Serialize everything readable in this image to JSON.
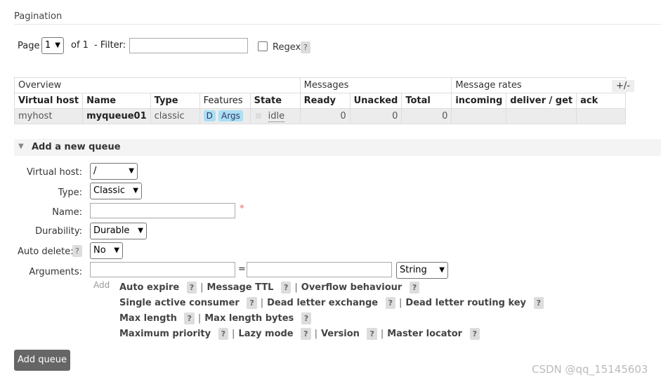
{
  "pagination": {
    "heading": "Pagination",
    "page_label": "Page",
    "page_value": "1",
    "of_label": "of 1",
    "filter_label": "- Filter:",
    "filter_value": "",
    "regex_label": "Regex",
    "help": "?"
  },
  "table": {
    "group_headers": [
      "Overview",
      "Messages",
      "Message rates"
    ],
    "toggle": "+/-",
    "columns": [
      "Virtual host",
      "Name",
      "Type",
      "Features",
      "State",
      "Ready",
      "Unacked",
      "Total",
      "incoming",
      "deliver / get",
      "ack"
    ],
    "row": {
      "vhost": "myhost",
      "name": "myqueue01",
      "type": "classic",
      "feature_d": "D",
      "feature_args": "Args",
      "state": "idle",
      "ready": "0",
      "unacked": "0",
      "total": "0"
    }
  },
  "form": {
    "section_title": "Add a new queue",
    "vhost_label": "Virtual host:",
    "vhost_value": "/",
    "type_label": "Type:",
    "type_value": "Classic",
    "name_label": "Name:",
    "required_mark": "*",
    "durability_label": "Durability:",
    "durability_value": "Durable",
    "autodelete_label": "Auto delete:",
    "autodelete_value": "No",
    "arguments_label": "Arguments:",
    "equals": "=",
    "arg_type_value": "String",
    "add_label": "Add",
    "arg_links": {
      "auto_expire": "Auto expire",
      "message_ttl": "Message TTL",
      "overflow": "Overflow behaviour",
      "single_active": "Single active consumer",
      "dlx": "Dead letter exchange",
      "dlrk": "Dead letter routing key",
      "max_length": "Max length",
      "max_length_bytes": "Max length bytes",
      "max_priority": "Maximum priority",
      "lazy_mode": "Lazy mode",
      "version": "Version",
      "master_locator": "Master locator"
    },
    "separator": "|",
    "submit": "Add queue"
  },
  "watermark": "CSDN @qq_15145603"
}
